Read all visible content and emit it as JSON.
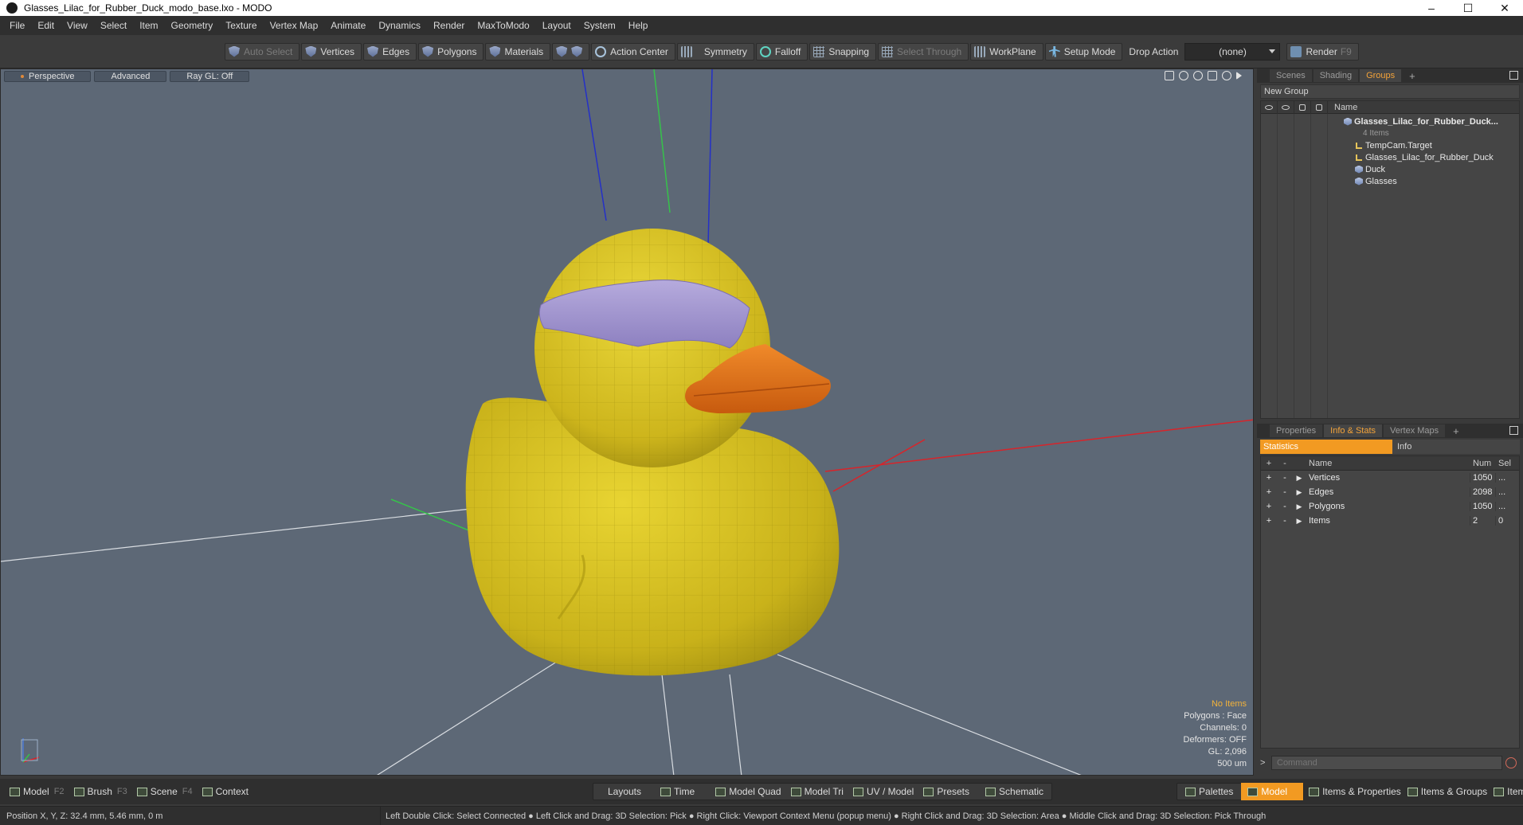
{
  "window": {
    "title": "Glasses_Lilac_for_Rubber_Duck_modo_base.lxo - MODO",
    "controls": {
      "minimize": "–",
      "maximize": "☐",
      "close": "✕"
    }
  },
  "menu": [
    "File",
    "Edit",
    "View",
    "Select",
    "Item",
    "Geometry",
    "Texture",
    "Vertex Map",
    "Animate",
    "Dynamics",
    "Render",
    "MaxToModo",
    "Layout",
    "System",
    "Help"
  ],
  "toolbar": {
    "auto_select": "Auto Select",
    "vertices": "Vertices",
    "edges": "Edges",
    "polygons": "Polygons",
    "materials": "Materials",
    "action_center": "Action Center",
    "symmetry": "Symmetry",
    "falloff": "Falloff",
    "snapping": "Snapping",
    "select_through": "Select Through",
    "workplane": "WorkPlane",
    "setup_mode": "Setup Mode",
    "drop_action_label": "Drop Action",
    "drop_action_value": "(none)",
    "render": "Render",
    "render_key": "F9"
  },
  "viewport": {
    "tabs": {
      "view": "Perspective",
      "shading": "Advanced",
      "raygl": "Ray GL: Off"
    },
    "info": {
      "items": "No Items",
      "polygons": "Polygons : Face",
      "channels": "Channels: 0",
      "deformers": "Deformers: OFF",
      "gl": "GL: 2,096",
      "unit": "500 um"
    },
    "colors": {
      "background": "#5d6876",
      "duck": "#d8c21e",
      "beak": "#e0731a",
      "glasses": "#a79ad0"
    }
  },
  "scene_panel": {
    "tabs": [
      "Scenes",
      "Shading",
      "Groups"
    ],
    "active_tab": "Groups",
    "new_group": "New Group",
    "name_col": "Name",
    "group": {
      "name": "Glasses_Lilac_for_Rubber_Duck...",
      "count": "4 Items"
    },
    "items": [
      {
        "name": "TempCam.Target",
        "icon": "locator-icon"
      },
      {
        "name": "Glasses_Lilac_for_Rubber_Duck",
        "icon": "locator-icon"
      },
      {
        "name": "Duck",
        "icon": "mesh-icon"
      },
      {
        "name": "Glasses",
        "icon": "mesh-icon"
      }
    ]
  },
  "stats_panel": {
    "tabs": [
      "Properties",
      "Info & Stats",
      "Vertex Maps"
    ],
    "active_tab": "Info & Stats",
    "sub_tabs": {
      "statistics": "Statistics",
      "info": "Info"
    },
    "head": {
      "plus": "+",
      "minus": "-",
      "name": "Name",
      "num": "Num",
      "sel": "Sel"
    },
    "rows": [
      {
        "name": "Vertices",
        "num": "1050",
        "sel": "..."
      },
      {
        "name": "Edges",
        "num": "2098",
        "sel": "..."
      },
      {
        "name": "Polygons",
        "num": "1050",
        "sel": "..."
      },
      {
        "name": "Items",
        "num": "2",
        "sel": "0"
      }
    ],
    "command_placeholder": "Command"
  },
  "bottom": {
    "model": "Model",
    "model_key": "F2",
    "brush": "Brush",
    "brush_key": "F3",
    "scene": "Scene",
    "scene_key": "F4",
    "context": "Context",
    "layouts": "Layouts",
    "time": "Time",
    "model_quad": "Model Quad",
    "model_tri": "Model Tri",
    "uv_model": "UV / Model",
    "presets": "Presets",
    "schematic": "Schematic",
    "palettes": "Palettes",
    "model_right": "Model",
    "items_properties": "Items & Properties",
    "items_groups": "Items & Groups",
    "items_shading": "Items & Shading"
  },
  "status": {
    "position": "Position X, Y, Z:   32.4 mm, 5.46 mm, 0 m",
    "hint": "Left Double Click: Select Connected ● Left Click and Drag: 3D Selection: Pick ● Right Click: Viewport Context Menu (popup menu) ● Right Click and Drag: 3D Selection: Area ● Middle Click and Drag: 3D Selection: Pick Through"
  }
}
